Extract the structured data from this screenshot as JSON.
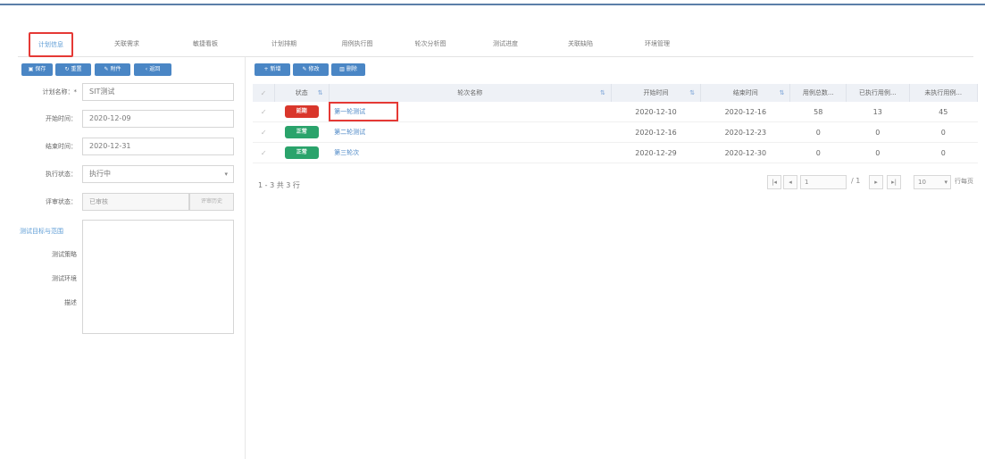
{
  "tabs": [
    {
      "label": "计划信息",
      "active": true
    },
    {
      "label": "关联需求",
      "active": false
    },
    {
      "label": "敏捷看板",
      "active": false
    },
    {
      "label": "计划排期",
      "active": false
    },
    {
      "label": "用例执行图",
      "active": false
    },
    {
      "label": "轮次分析图",
      "active": false
    },
    {
      "label": "测试进度",
      "active": false
    },
    {
      "label": "关联缺陷",
      "active": false
    },
    {
      "label": "环境管理",
      "active": false
    }
  ],
  "left_toolbar": {
    "save_label": "保存",
    "reset_label": "重置",
    "attachment_label": "附件",
    "back_label": "返回"
  },
  "form": {
    "plan_name_label": "计划名称：*",
    "plan_name_value": "SIT测试",
    "start_label": "开始时间：",
    "start_value": "2020-12-09",
    "end_label": "结束时间：",
    "end_value": "2020-12-31",
    "exec_status_label": "执行状态：",
    "exec_status_value": "执行中",
    "review_status_label": "评审状态：",
    "review_status_value": "已审核",
    "review_button_label": "评审历史",
    "section_label": "测试目标与范围",
    "strategy_label": "测试策略",
    "env_label": "测试环境",
    "desc_label": "描述"
  },
  "right_toolbar": {
    "add_label": "新增",
    "edit_label": "修改",
    "delete_label": "删除"
  },
  "table": {
    "headers": {
      "status": "状态",
      "name": "轮次名称",
      "start": "开始时间",
      "end": "结束时间",
      "total": "用例总数...",
      "executed": "已执行用例...",
      "not_executed": "未执行用例..."
    },
    "rows": [
      {
        "status": "延期",
        "status_color": "#d9362b",
        "name": "第一轮测试",
        "start": "2020-12-10",
        "end": "2020-12-16",
        "total": "58",
        "executed": "13",
        "not_executed": "45"
      },
      {
        "status": "正常",
        "status_color": "#2aa36b",
        "name": "第二轮测试",
        "start": "2020-12-16",
        "end": "2020-12-23",
        "total": "0",
        "executed": "0",
        "not_executed": "0"
      },
      {
        "status": "正常",
        "status_color": "#2aa36b",
        "name": "第三轮次",
        "start": "2020-12-29",
        "end": "2020-12-30",
        "total": "0",
        "executed": "0",
        "not_executed": "0"
      }
    ]
  },
  "pagination": {
    "summary": "1 - 3 共 3 行",
    "page_input": "1",
    "page_total": "/ 1",
    "page_size": "10",
    "page_size_suffix": "行每页"
  },
  "colors": {
    "accent": "#4a86c5",
    "highlight_border": "#e53935",
    "status_delayed": "#d9362b",
    "status_normal": "#2aa36b"
  }
}
